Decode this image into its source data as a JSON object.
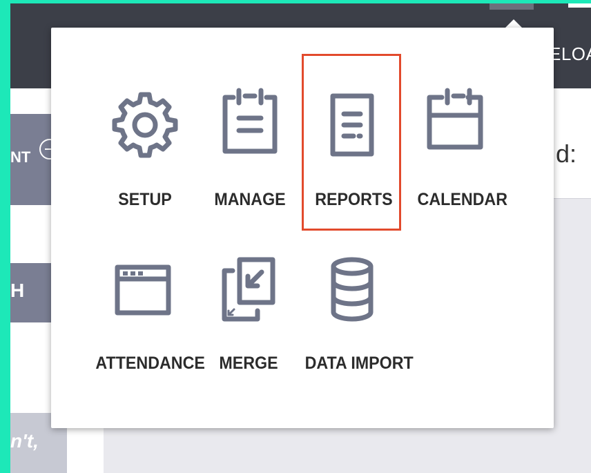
{
  "header": {
    "reload_text": "ELOA"
  },
  "sidebar": {
    "button1_text": "NT",
    "button2_text": "H",
    "button3_text": "n't,"
  },
  "main": {
    "heading_fragment": "d:"
  },
  "menu": {
    "items": [
      {
        "label": "SETUP",
        "icon": "gear-icon"
      },
      {
        "label": "MANAGE",
        "icon": "clipboard-icon"
      },
      {
        "label": "REPORTS",
        "icon": "report-icon",
        "selected": true
      },
      {
        "label": "CALENDAR",
        "icon": "calendar-icon"
      },
      {
        "label": "ATTENDANCE",
        "icon": "window-icon"
      },
      {
        "label": "MERGE",
        "icon": "merge-icon"
      },
      {
        "label": "DATA IMPORT",
        "icon": "database-icon"
      }
    ]
  },
  "colors": {
    "accent_outline": "#e24a2c",
    "icon": "#6e7488",
    "frame": "#1de8b8",
    "topbar": "#3c3f48"
  }
}
